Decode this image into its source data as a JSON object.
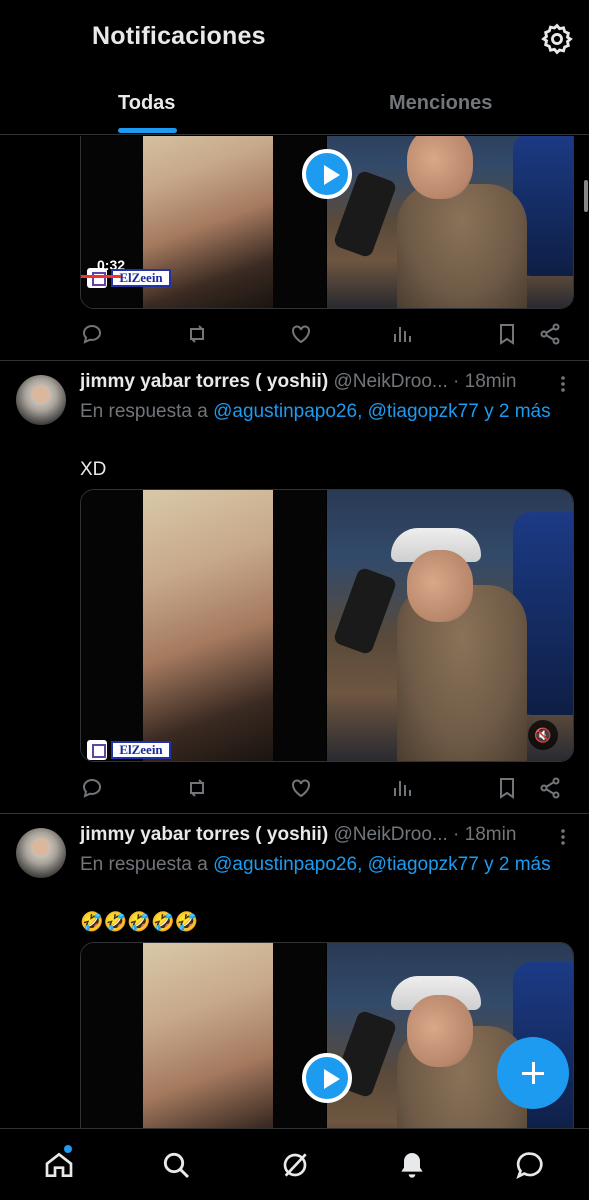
{
  "header": {
    "title": "Notificaciones",
    "tabs": [
      {
        "label": "Todas",
        "active": true
      },
      {
        "label": "Menciones",
        "active": false
      }
    ]
  },
  "icons": {
    "settings": "gear-icon",
    "reply": "comment-icon",
    "retweet": "retweet-icon",
    "like": "heart-icon",
    "views": "chart-icon",
    "bookmark": "bookmark-icon",
    "share": "share-icon",
    "more": "more-vertical-icon",
    "play": "play-icon",
    "mute": "mute-icon",
    "compose": "plus-icon"
  },
  "posts": [
    {
      "video": {
        "time": "0:32",
        "watermark": "ElZeein"
      }
    },
    {
      "author": "jimmy yabar torres ( yoshii)",
      "handle": "@NeikDroo...",
      "sep": "·",
      "time": "18min",
      "reply_prefix": "En respuesta a",
      "reply_mention1": "@agustinpapo26",
      "reply_comma": ",",
      "reply_mention2": "@tiagopzk77 y 2 más",
      "text": "XD",
      "video": {
        "watermark": "ElZeein"
      }
    },
    {
      "author": "jimmy yabar torres ( yoshii)",
      "handle": "@NeikDroo...",
      "sep": "·",
      "time": "18min",
      "reply_prefix": "En respuesta a",
      "reply_mention1": "@agustinpapo26",
      "reply_comma": ",",
      "reply_mention2": "@tiagopzk77 y 2 más",
      "text": "🤣🤣🤣🤣🤣"
    }
  ],
  "bottom_nav": [
    "home-icon",
    "search-icon",
    "grok-icon",
    "bell-icon",
    "messages-icon"
  ],
  "colors": {
    "accent": "#1d9bf0",
    "background": "#000000",
    "text": "#e7e9ea",
    "muted": "#71767b"
  }
}
